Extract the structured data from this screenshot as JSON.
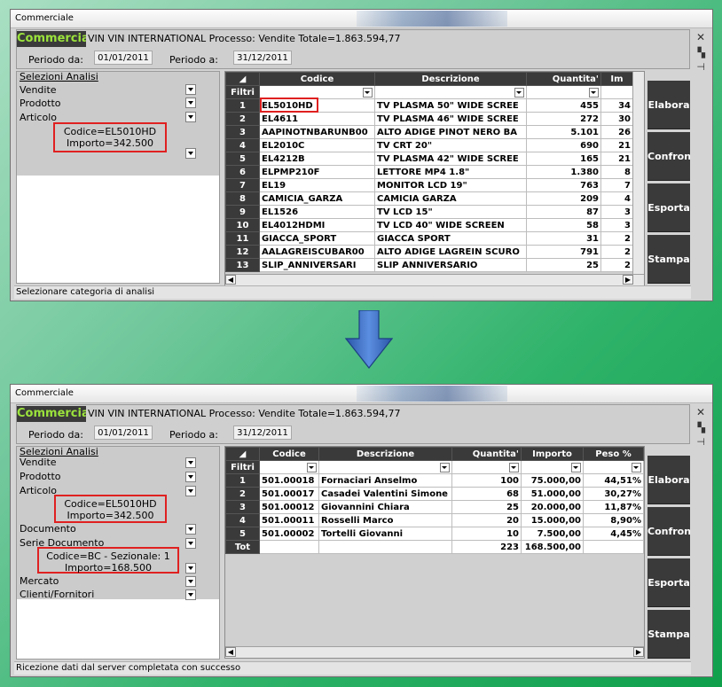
{
  "window1": {
    "title": "Commerciale",
    "app_name": "Commerciale",
    "company": "VIN VIN INTERNATIONAL  Processo: Vendite Totale=1.863.594,77",
    "periodo_da_label": "Periodo da:",
    "periodo_da": "01/01/2011",
    "periodo_a_label": "Periodo a:",
    "periodo_a": "31/12/2011",
    "selezioni_label": "Selezioni Analisi",
    "selections": [
      "Vendite",
      "Prodotto",
      "Articolo"
    ],
    "highlight": {
      "codice": "Codice=EL5010HD",
      "importo": "Importo=342.500"
    },
    "columns": [
      "Codice",
      "Descrizione",
      "Quantita'",
      "Im"
    ],
    "filter_label": "Filtri",
    "rows": [
      {
        "n": "1",
        "codice": "EL5010HD",
        "descr": "TV PLASMA 50\" WIDE SCREE",
        "qta": "455",
        "imp": "34"
      },
      {
        "n": "2",
        "codice": "EL4611",
        "descr": "TV PLASMA 46\" WIDE SCREE",
        "qta": "272",
        "imp": "30"
      },
      {
        "n": "3",
        "codice": "AAPINOTNBARUNB00",
        "descr": "ALTO ADIGE PINOT NERO BA",
        "qta": "5.101",
        "imp": "26"
      },
      {
        "n": "4",
        "codice": "EL2010C",
        "descr": "TV CRT 20\"",
        "qta": "690",
        "imp": "21"
      },
      {
        "n": "5",
        "codice": "EL4212B",
        "descr": "TV PLASMA 42\" WIDE SCREE",
        "qta": "165",
        "imp": "21"
      },
      {
        "n": "6",
        "codice": "ELPMP210F",
        "descr": "LETTORE MP4 1.8\"",
        "qta": "1.380",
        "imp": "8"
      },
      {
        "n": "7",
        "codice": "EL19",
        "descr": "MONITOR LCD 19\"",
        "qta": "763",
        "imp": "7"
      },
      {
        "n": "8",
        "codice": "CAMICIA_GARZA",
        "descr": "CAMICIA GARZA",
        "qta": "209",
        "imp": "4"
      },
      {
        "n": "9",
        "codice": "EL1526",
        "descr": "TV LCD 15\"",
        "qta": "87",
        "imp": "3"
      },
      {
        "n": "10",
        "codice": "EL4012HDMI",
        "descr": "TV LCD 40\" WIDE SCREEN",
        "qta": "58",
        "imp": "3"
      },
      {
        "n": "11",
        "codice": "GIACCA_SPORT",
        "descr": "GIACCA SPORT",
        "qta": "31",
        "imp": "2"
      },
      {
        "n": "12",
        "codice": "AALAGREISCUBAR00",
        "descr": "ALTO ADIGE LAGREIN SCURO",
        "qta": "791",
        "imp": "2"
      },
      {
        "n": "13",
        "codice": "SLIP_ANNIVERSARI",
        "descr": "SLIP ANNIVERSARIO",
        "qta": "25",
        "imp": "2"
      }
    ],
    "actions": [
      "Elabora",
      "Confronta",
      "Esporta",
      "Stampa"
    ],
    "status": "Selezionare categoria di analisi"
  },
  "window2": {
    "title": "Commerciale",
    "app_name": "Commerciale",
    "company": "VIN VIN INTERNATIONAL  Processo: Vendite Totale=1.863.594,77",
    "periodo_da_label": "Periodo da:",
    "periodo_da": "01/01/2011",
    "periodo_a_label": "Periodo a:",
    "periodo_a": "31/12/2011",
    "selezioni_label": "Selezioni Analisi",
    "selections_top": [
      "Vendite",
      "Prodotto",
      "Articolo"
    ],
    "highlight1": {
      "codice": "Codice=EL5010HD",
      "importo": "Importo=342.500"
    },
    "selections_mid": [
      "Documento",
      "Serie Documento"
    ],
    "highlight2": {
      "codice": "Codice=BC - Sezionale: 1",
      "importo": "Importo=168.500"
    },
    "selections_bottom": [
      "Mercato",
      "Clienti/Fornitori"
    ],
    "columns": [
      "Codice",
      "Descrizione",
      "Quantita'",
      "Importo",
      "Peso %"
    ],
    "filter_label": "Filtri",
    "rows": [
      {
        "n": "1",
        "codice": "501.00018",
        "descr": "Fornaciari Anselmo",
        "qta": "100",
        "imp": "75.000,00",
        "peso": "44,51%"
      },
      {
        "n": "2",
        "codice": "501.00017",
        "descr": "Casadei Valentini Simone",
        "qta": "68",
        "imp": "51.000,00",
        "peso": "30,27%"
      },
      {
        "n": "3",
        "codice": "501.00012",
        "descr": "Giovannini Chiara",
        "qta": "25",
        "imp": "20.000,00",
        "peso": "11,87%"
      },
      {
        "n": "4",
        "codice": "501.00011",
        "descr": "Rosselli Marco",
        "qta": "20",
        "imp": "15.000,00",
        "peso": "8,90%"
      },
      {
        "n": "5",
        "codice": "501.00002",
        "descr": "Tortelli Giovanni",
        "qta": "10",
        "imp": "7.500,00",
        "peso": "4,45%"
      }
    ],
    "total": {
      "label": "Tot",
      "qta": "223",
      "imp": "168.500,00"
    },
    "actions": [
      "Elabora",
      "Confronta",
      "Esporta",
      "Stampa"
    ],
    "status": "Ricezione dati dal server completata con successo"
  },
  "colors": {
    "arrow": "#3f6fc6",
    "highlight": "#e02020",
    "app_name": "#9be33c",
    "dark_header": "#3a3a3a"
  }
}
